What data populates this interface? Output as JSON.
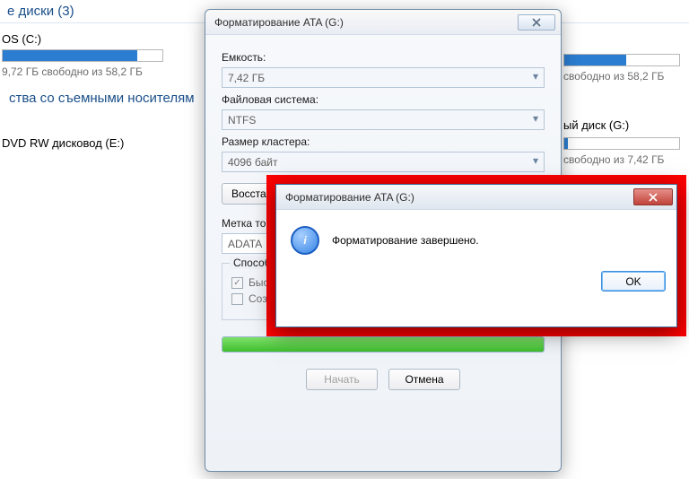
{
  "explorer": {
    "group_disks_title": "е диски (3)",
    "drive_c": {
      "name": "OS (C:)",
      "free": "9,72 ГБ свободно из 58,2 ГБ",
      "fill_pct": 84
    },
    "group_removable_title": "ства со съемными носителям",
    "drive_e": {
      "name": "DVD RW дисковод (E:)"
    },
    "right_1": {
      "free": "свободно из 58,2 ГБ",
      "fill_pct": 54
    },
    "right_2": {
      "name": "ый диск (G:)",
      "free": "свободно из 7,42 ГБ",
      "fill_pct": 3
    }
  },
  "format_dialog": {
    "title": "Форматирование ATA (G:)",
    "labels": {
      "capacity": "Емкость:",
      "filesystem": "Файловая система:",
      "cluster": "Размер кластера:",
      "volume_label": "Метка тома:",
      "methods_title": "Способы форматирования:"
    },
    "values": {
      "capacity": "7,42 ГБ",
      "filesystem": "NTFS",
      "cluster": "4096 байт",
      "volume_label": "ADATA"
    },
    "buttons": {
      "restore": "Восстановить параметры по умолчанию",
      "start": "Начать",
      "cancel": "Отмена"
    },
    "checkboxes": {
      "quick": "Быстрое (очистка оглавления)",
      "msdos": "Создание загрузочного диска MS-DOS"
    },
    "quick_checked": true,
    "progress_pct": 100
  },
  "alert": {
    "title": "Форматирование ATA (G:)",
    "message": "Форматирование завершено.",
    "ok": "OK",
    "icon": "i"
  }
}
